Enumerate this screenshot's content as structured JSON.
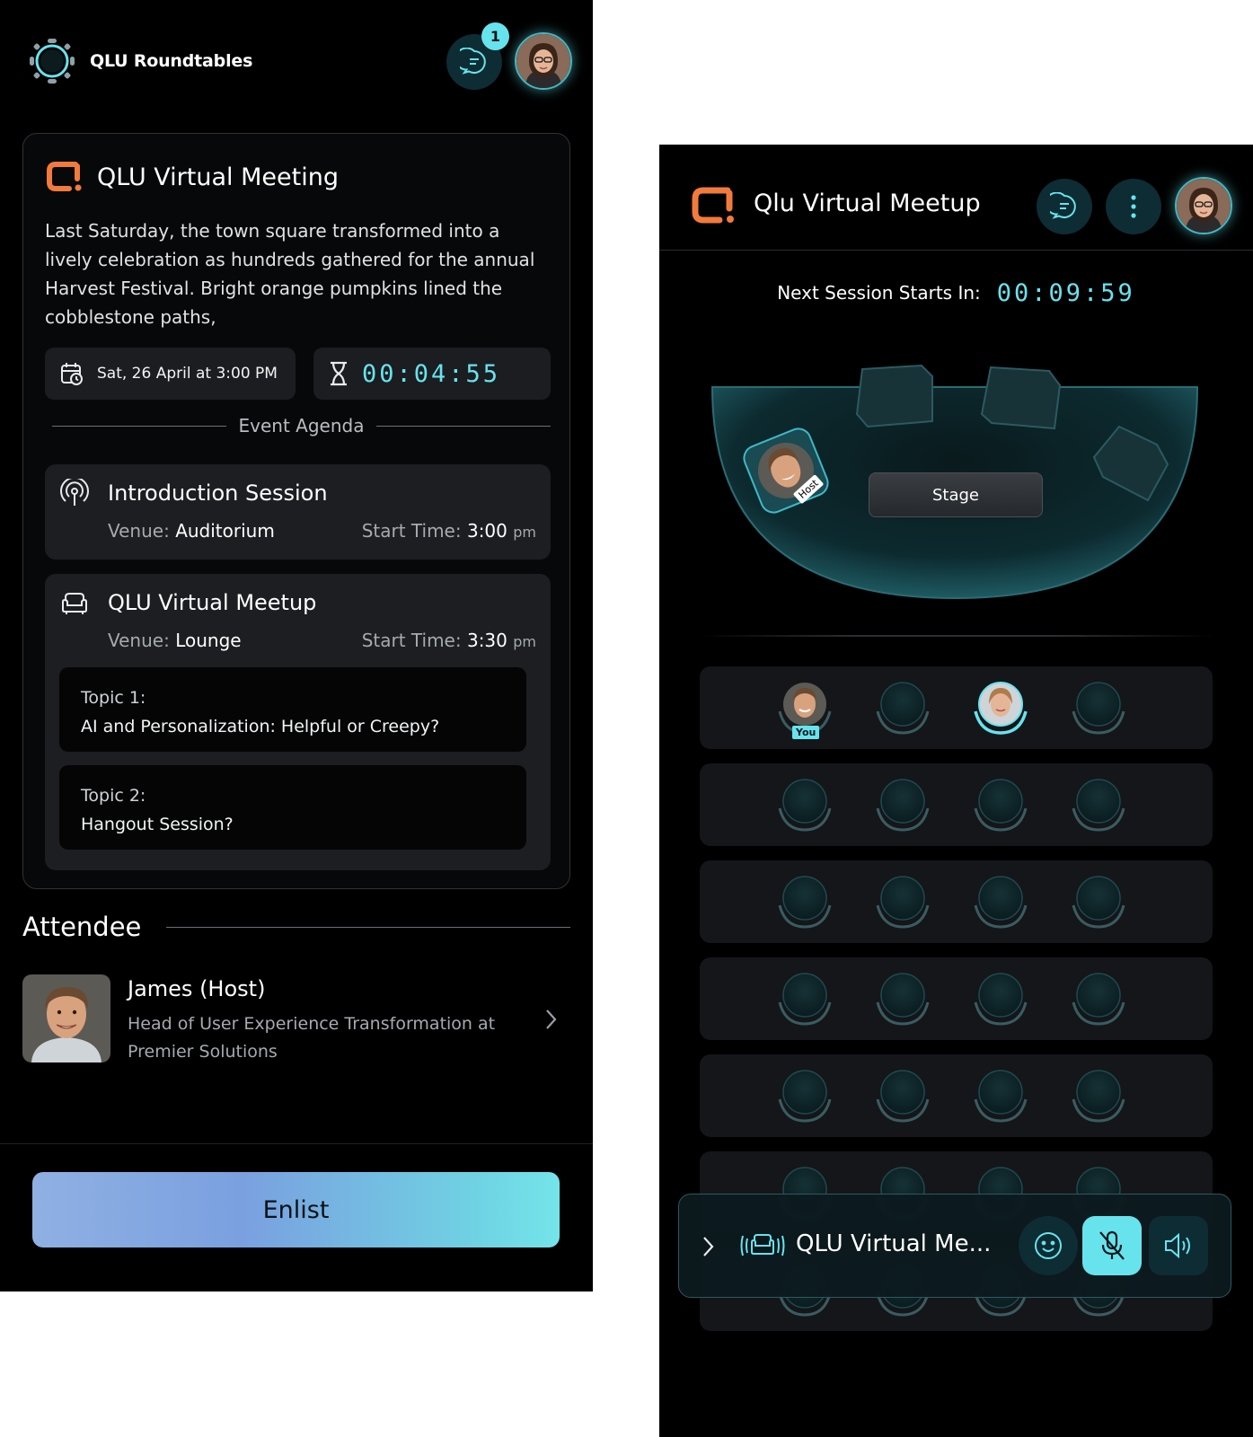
{
  "left": {
    "app_name": "QLU Roundtables",
    "notification_count": "1",
    "event": {
      "title": "QLU Virtual Meeting",
      "description": "Last Saturday, the town square transformed into a lively celebration as hundreds gathered for the annual Harvest Festival. Bright orange pumpkins lined the cobblestone paths,",
      "date": "Sat, 26 April at 3:00 PM",
      "countdown": "00:04:55",
      "agenda_label": "Event Agenda",
      "sessions": [
        {
          "title": "Introduction Session",
          "venue_label": "Venue:",
          "venue": "Auditorium",
          "time_label": "Start Time:",
          "time": "3:00",
          "ampm": "pm",
          "icon": "podcast-icon"
        },
        {
          "title": "QLU Virtual Meetup",
          "venue_label": "Venue:",
          "venue": "Lounge",
          "time_label": "Start Time:",
          "time": "3:30",
          "ampm": "pm",
          "icon": "sofa-icon",
          "topics": [
            {
              "label": "Topic 1:",
              "value": "AI and Personalization: Helpful or Creepy?"
            },
            {
              "label": "Topic 2:",
              "value": "Hangout Session?"
            }
          ]
        }
      ]
    },
    "attendee_heading": "Attendee",
    "attendee": {
      "name": "James (Host)",
      "role": "Head of User Experience Transformation at Premier Solutions"
    },
    "enlist_label": "Enlist"
  },
  "right": {
    "title": "Qlu Virtual Meetup",
    "next_session_label": "Next Session Starts In:",
    "next_session_countdown": "00:09:59",
    "stage_label": "Stage",
    "host_tag": "Host",
    "you_tag": "You",
    "control_bar_title": "QLU Virtual Me...",
    "mic_state": "muted"
  },
  "colors": {
    "accent": "#67e3ee",
    "brand_orange": "#f27a3c",
    "background": "#000000",
    "card": "#1c1e21"
  }
}
